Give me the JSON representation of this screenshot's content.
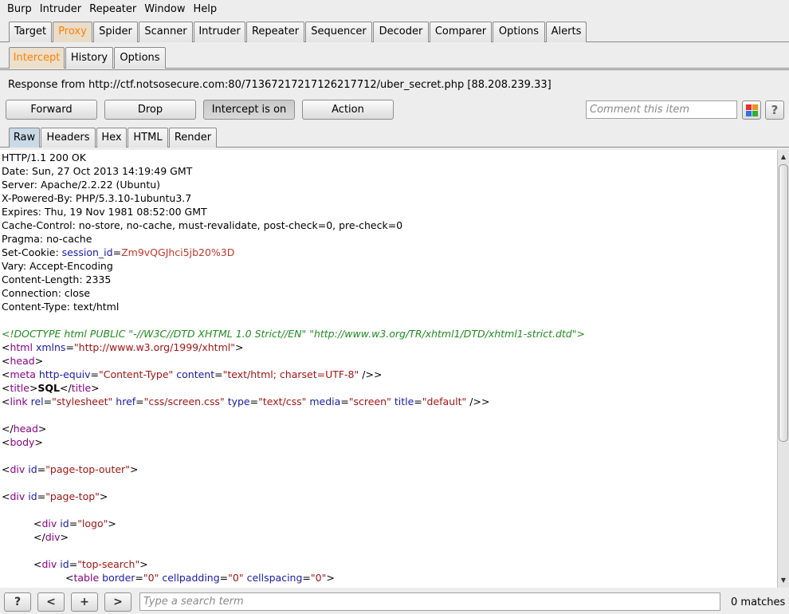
{
  "menu": [
    "Burp",
    "Intruder",
    "Repeater",
    "Window",
    "Help"
  ],
  "main_tabs": [
    "Target",
    "Proxy",
    "Spider",
    "Scanner",
    "Intruder",
    "Repeater",
    "Sequencer",
    "Decoder",
    "Comparer",
    "Options",
    "Alerts"
  ],
  "active_main_tab": "Proxy",
  "proxy_tabs": [
    "Intercept",
    "History",
    "Options"
  ],
  "active_proxy_tab": "Intercept",
  "response_label": "Response from http://ctf.notsosecure.com:80/71367217217126217712/uber_secret.php  [88.208.239.33]",
  "buttons": {
    "forward": "Forward",
    "drop": "Drop",
    "intercept": "Intercept is on",
    "action": "Action"
  },
  "comment_placeholder": "Comment this item",
  "help_label": "?",
  "editor_tabs": [
    "Raw",
    "Headers",
    "Hex",
    "HTML",
    "Render"
  ],
  "active_editor_tab": "Raw",
  "headers": [
    "HTTP/1.1 200 OK",
    "Date: Sun, 27 Oct 2013 14:19:49 GMT",
    "Server: Apache/2.2.22 (Ubuntu)",
    "X-Powered-By: PHP/5.3.10-1ubuntu3.7",
    "Expires: Thu, 19 Nov 1981 08:52:00 GMT",
    "Cache-Control: no-store, no-cache, must-revalidate, post-check=0, pre-check=0",
    "Pragma: no-cache"
  ],
  "set_cookie": {
    "prefix": "Set-Cookie: ",
    "name": "session_id",
    "eq": "=",
    "value": "Zm9vQGJhci5jb20%3D"
  },
  "headers_after": [
    "Vary: Accept-Encoding",
    "Content-Length: 2335",
    "Connection: close",
    "Content-Type: text/html"
  ],
  "body": {
    "doctype": "<!DOCTYPE html PUBLIC \"-//W3C//DTD XHTML 1.0 Strict//EN\" \"http://www.w3.org/TR/xhtml1/DTD/xhtml1-strict.dtd\">",
    "html_open": {
      "tag": "html",
      "attr": "xmlns",
      "val": "\"http://www.w3.org/1999/xhtml\""
    },
    "head_open": "head",
    "meta": {
      "tag": "meta",
      "a1": "http-equiv",
      "v1": "\"Content-Type\"",
      "a2": "content",
      "v2": "\"text/html; charset=UTF-8\"",
      "close": " />"
    },
    "title": {
      "tag": "title",
      "text": "SQL"
    },
    "link": {
      "tag": "link",
      "a1": "rel",
      "v1": "\"stylesheet\"",
      "a2": "href",
      "v2": "\"css/screen.css\"",
      "a3": "type",
      "v3": "\"text/css\"",
      "a4": "media",
      "v4": "\"screen\"",
      "a5": "title",
      "v5": "\"default\"",
      "close": " />"
    },
    "head_close": "head",
    "body_open": "body",
    "div1": {
      "tag": "div",
      "attr": "id",
      "val": "\"page-top-outer\""
    },
    "div2": {
      "tag": "div",
      "attr": "id",
      "val": "\"page-top\""
    },
    "div3": {
      "tag": "div",
      "attr": "id",
      "val": "\"logo\""
    },
    "div3_close": "div",
    "div4": {
      "tag": "div",
      "attr": "id",
      "val": "\"top-search\""
    },
    "table": {
      "tag": "table",
      "a1": "border",
      "v1": "\"0\"",
      "a2": "cellpadding",
      "v2": "\"0\"",
      "a3": "cellspacing",
      "v3": "\"0\""
    }
  },
  "search_placeholder": "Type a search term",
  "search_buttons": [
    "?",
    "<",
    "+",
    ">"
  ],
  "matches": "0 matches"
}
